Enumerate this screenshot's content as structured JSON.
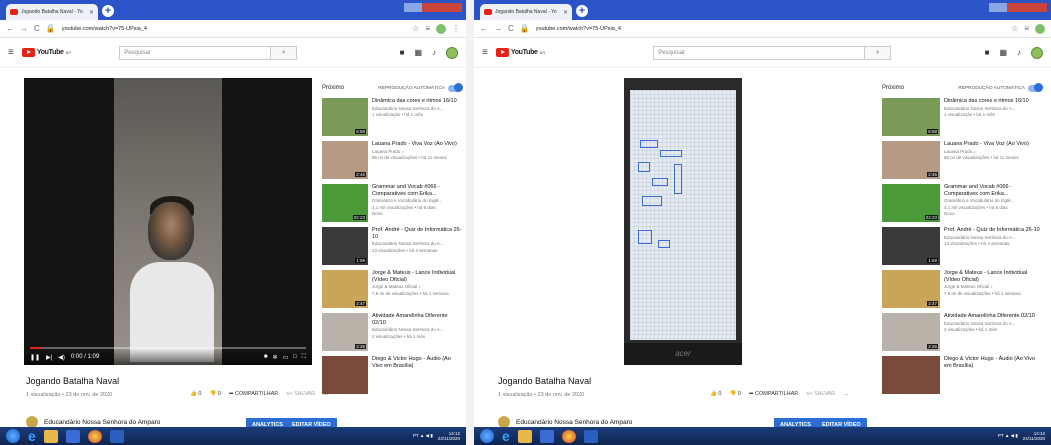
{
  "screens": [
    {
      "tab_title": "Jogando Batalha Naval - Yo",
      "url": "youtube.com/watch?v=75-UPsia_4",
      "search_placeholder": "Pesquisar",
      "video_title": "Jogando Batalha Naval",
      "video_meta": "1 visualização • 23 de nov. de 2020",
      "time": "0:00 / 1:09",
      "likes": "0",
      "dislikes": "0",
      "share": "COMPARTILHAR",
      "save": "SALVAR",
      "channel": "Educandário Nossa Senhora do Amparo",
      "analytics_btn": "ANALYTICS",
      "edit_btn": "EDITAR VÍDEO",
      "tray_time": "14:12",
      "tray_date": "24/11/2020"
    },
    {
      "tab_title": "Jogando Batalha Naval - Yo",
      "url": "youtube.com/watch?v=75-UPsia_4",
      "search_placeholder": "Pesquisar",
      "video_title": "Jogando Batalha Naval",
      "video_meta": "1 visualização • 23 de nov. de 2020",
      "likes": "0",
      "dislikes": "0",
      "share": "COMPARTILHAR",
      "save": "SALVAR",
      "channel": "Educandário Nossa Senhora do Amparo",
      "analytics_btn": "ANALYTICS",
      "edit_btn": "EDITAR VÍDEO",
      "monitor_brand": "acer",
      "tray_time": "14:12",
      "tray_date": "24/11/2020"
    }
  ],
  "sidebar": {
    "next_label": "Próximo",
    "autoplay_label": "REPRODUÇÃO AUTOMÁTICA",
    "items": [
      {
        "title": "Dinâmica das cores e ritmos 16/10",
        "channel": "Educandário Nossa Senhora do A...",
        "meta": "1 visualização • há 1 mês",
        "duration": "6:58",
        "color": "#7a9a5a"
      },
      {
        "title": "Lauana Prado - Viva Voz (Ao Vivo)",
        "channel": "Lauana Prado ♪",
        "meta": "85 mi de visualizações • há 11 meses",
        "duration": "2:46",
        "color": "#b79a86"
      },
      {
        "title": "Grammar and Vocab #066 - Comparatives com Erika...",
        "channel": "Gramática e Vocabulário do Inglê...",
        "meta": "4,1 mil visualizações • há 6 dias",
        "badge": "Novo",
        "duration": "02:23",
        "color": "#4a9a3a"
      },
      {
        "title": "Prof. André - Quiz de Informática 26-10",
        "channel": "Educandário Nossa Senhora do A...",
        "meta": "13 visualizações • há 4 semanas",
        "duration": "1:59",
        "color": "#3a3a3a"
      },
      {
        "title": "Jorge & Mateus - Lance Individual (Vídeo Oficial)",
        "channel": "Jorge & Mateus Oficial ♪",
        "meta": "7,9 mi de visualizações • há 1 semana",
        "duration": "2:47",
        "color": "#c9a55a"
      },
      {
        "title": "Atividade Amarelinha Diferente 02/10",
        "channel": "Educandário Nossa Senhora do A...",
        "meta": "2 visualizações • há 1 mês",
        "duration": "2:26",
        "color": "#b8b2a8"
      },
      {
        "title": "Diego & Victor Hugo - Áudio (Ao Vivo em Brasília)",
        "channel": "",
        "meta": "",
        "duration": "",
        "color": "#7a4a3a"
      }
    ]
  }
}
